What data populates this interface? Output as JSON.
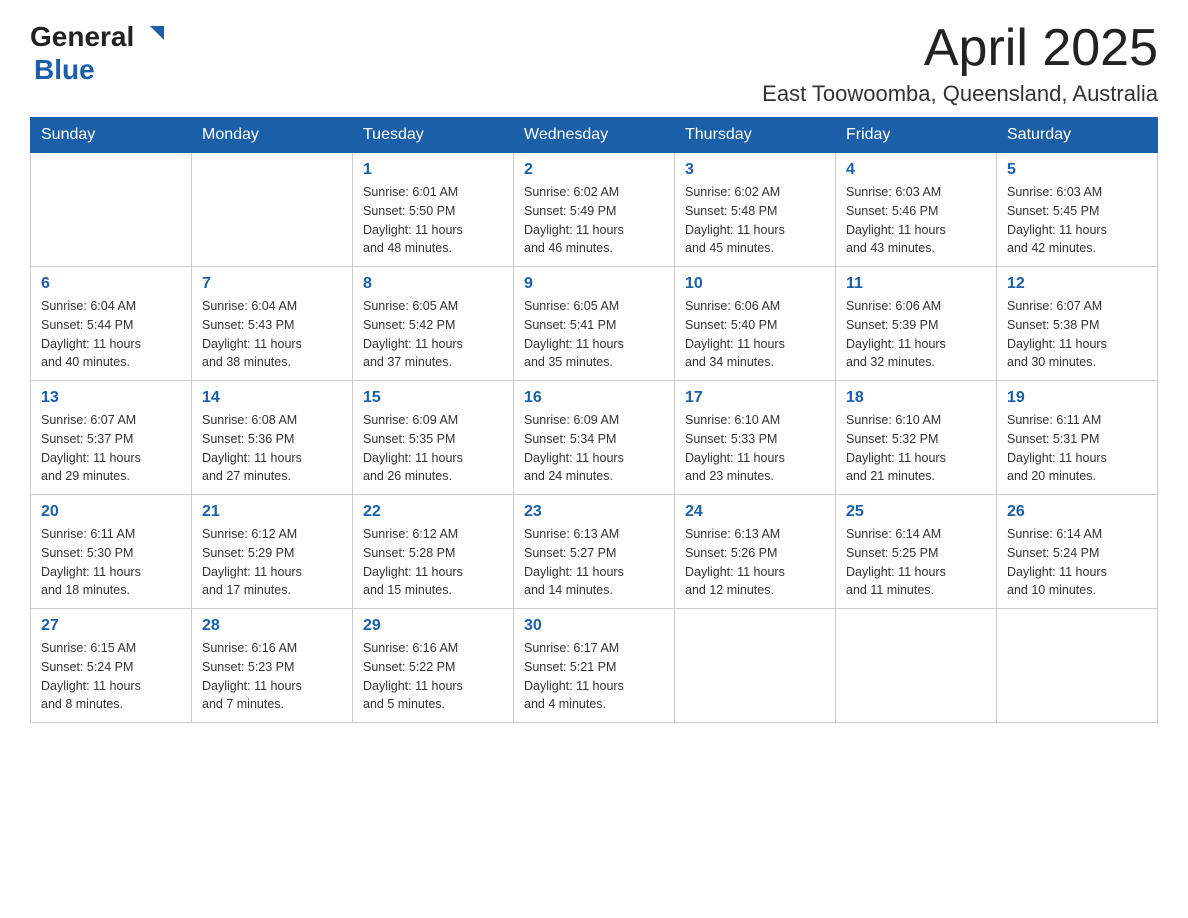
{
  "logo": {
    "general": "General",
    "blue": "Blue",
    "arrow": "▶"
  },
  "title": {
    "month_year": "April 2025",
    "location": "East Toowoomba, Queensland, Australia"
  },
  "weekdays": [
    "Sunday",
    "Monday",
    "Tuesday",
    "Wednesday",
    "Thursday",
    "Friday",
    "Saturday"
  ],
  "weeks": [
    [
      {
        "day": "",
        "info": ""
      },
      {
        "day": "",
        "info": ""
      },
      {
        "day": "1",
        "info": "Sunrise: 6:01 AM\nSunset: 5:50 PM\nDaylight: 11 hours\nand 48 minutes."
      },
      {
        "day": "2",
        "info": "Sunrise: 6:02 AM\nSunset: 5:49 PM\nDaylight: 11 hours\nand 46 minutes."
      },
      {
        "day": "3",
        "info": "Sunrise: 6:02 AM\nSunset: 5:48 PM\nDaylight: 11 hours\nand 45 minutes."
      },
      {
        "day": "4",
        "info": "Sunrise: 6:03 AM\nSunset: 5:46 PM\nDaylight: 11 hours\nand 43 minutes."
      },
      {
        "day": "5",
        "info": "Sunrise: 6:03 AM\nSunset: 5:45 PM\nDaylight: 11 hours\nand 42 minutes."
      }
    ],
    [
      {
        "day": "6",
        "info": "Sunrise: 6:04 AM\nSunset: 5:44 PM\nDaylight: 11 hours\nand 40 minutes."
      },
      {
        "day": "7",
        "info": "Sunrise: 6:04 AM\nSunset: 5:43 PM\nDaylight: 11 hours\nand 38 minutes."
      },
      {
        "day": "8",
        "info": "Sunrise: 6:05 AM\nSunset: 5:42 PM\nDaylight: 11 hours\nand 37 minutes."
      },
      {
        "day": "9",
        "info": "Sunrise: 6:05 AM\nSunset: 5:41 PM\nDaylight: 11 hours\nand 35 minutes."
      },
      {
        "day": "10",
        "info": "Sunrise: 6:06 AM\nSunset: 5:40 PM\nDaylight: 11 hours\nand 34 minutes."
      },
      {
        "day": "11",
        "info": "Sunrise: 6:06 AM\nSunset: 5:39 PM\nDaylight: 11 hours\nand 32 minutes."
      },
      {
        "day": "12",
        "info": "Sunrise: 6:07 AM\nSunset: 5:38 PM\nDaylight: 11 hours\nand 30 minutes."
      }
    ],
    [
      {
        "day": "13",
        "info": "Sunrise: 6:07 AM\nSunset: 5:37 PM\nDaylight: 11 hours\nand 29 minutes."
      },
      {
        "day": "14",
        "info": "Sunrise: 6:08 AM\nSunset: 5:36 PM\nDaylight: 11 hours\nand 27 minutes."
      },
      {
        "day": "15",
        "info": "Sunrise: 6:09 AM\nSunset: 5:35 PM\nDaylight: 11 hours\nand 26 minutes."
      },
      {
        "day": "16",
        "info": "Sunrise: 6:09 AM\nSunset: 5:34 PM\nDaylight: 11 hours\nand 24 minutes."
      },
      {
        "day": "17",
        "info": "Sunrise: 6:10 AM\nSunset: 5:33 PM\nDaylight: 11 hours\nand 23 minutes."
      },
      {
        "day": "18",
        "info": "Sunrise: 6:10 AM\nSunset: 5:32 PM\nDaylight: 11 hours\nand 21 minutes."
      },
      {
        "day": "19",
        "info": "Sunrise: 6:11 AM\nSunset: 5:31 PM\nDaylight: 11 hours\nand 20 minutes."
      }
    ],
    [
      {
        "day": "20",
        "info": "Sunrise: 6:11 AM\nSunset: 5:30 PM\nDaylight: 11 hours\nand 18 minutes."
      },
      {
        "day": "21",
        "info": "Sunrise: 6:12 AM\nSunset: 5:29 PM\nDaylight: 11 hours\nand 17 minutes."
      },
      {
        "day": "22",
        "info": "Sunrise: 6:12 AM\nSunset: 5:28 PM\nDaylight: 11 hours\nand 15 minutes."
      },
      {
        "day": "23",
        "info": "Sunrise: 6:13 AM\nSunset: 5:27 PM\nDaylight: 11 hours\nand 14 minutes."
      },
      {
        "day": "24",
        "info": "Sunrise: 6:13 AM\nSunset: 5:26 PM\nDaylight: 11 hours\nand 12 minutes."
      },
      {
        "day": "25",
        "info": "Sunrise: 6:14 AM\nSunset: 5:25 PM\nDaylight: 11 hours\nand 11 minutes."
      },
      {
        "day": "26",
        "info": "Sunrise: 6:14 AM\nSunset: 5:24 PM\nDaylight: 11 hours\nand 10 minutes."
      }
    ],
    [
      {
        "day": "27",
        "info": "Sunrise: 6:15 AM\nSunset: 5:24 PM\nDaylight: 11 hours\nand 8 minutes."
      },
      {
        "day": "28",
        "info": "Sunrise: 6:16 AM\nSunset: 5:23 PM\nDaylight: 11 hours\nand 7 minutes."
      },
      {
        "day": "29",
        "info": "Sunrise: 6:16 AM\nSunset: 5:22 PM\nDaylight: 11 hours\nand 5 minutes."
      },
      {
        "day": "30",
        "info": "Sunrise: 6:17 AM\nSunset: 5:21 PM\nDaylight: 11 hours\nand 4 minutes."
      },
      {
        "day": "",
        "info": ""
      },
      {
        "day": "",
        "info": ""
      },
      {
        "day": "",
        "info": ""
      }
    ]
  ]
}
